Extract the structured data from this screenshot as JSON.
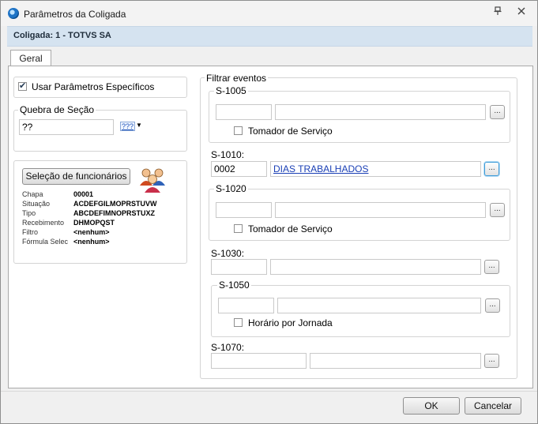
{
  "window": {
    "title": "Parâmetros da Coligada",
    "pin_icon": "pin-icon",
    "close_icon": "close-icon"
  },
  "header": {
    "text": "Coligada: 1 - TOTVS SA"
  },
  "tabs": [
    {
      "label": "Geral"
    }
  ],
  "left": {
    "usar_parametros": {
      "label": "Usar Parâmetros Específicos",
      "checked": true
    },
    "quebra": {
      "legend": "Quebra de Seção",
      "value": "??",
      "picker_label": "???"
    },
    "selecao": {
      "button_label": "Seleção de funcionários",
      "rows": [
        {
          "key": "Chapa",
          "value": "00001"
        },
        {
          "key": "Situação",
          "value": "ACDEFGILMOPRSTUVW"
        },
        {
          "key": "Tipo",
          "value": "ABCDEFIMNOPRSTUXZ"
        },
        {
          "key": "Recebimento",
          "value": "DHMOPQST"
        },
        {
          "key": "Filtro",
          "value": "<nenhum>"
        },
        {
          "key": "Fórmula Selec",
          "value": "<nenhum>"
        }
      ]
    }
  },
  "right": {
    "legend": "Filtrar eventos",
    "s1005": {
      "label": "S-1005",
      "code": "",
      "desc": "",
      "checkbox_label": "Tomador de Serviço",
      "button": "..."
    },
    "s1010": {
      "label": "S-1010:",
      "code": "0002",
      "desc": "DIAS TRABALHADOS",
      "button": "..."
    },
    "s1020": {
      "label": "S-1020",
      "code": "",
      "desc": "",
      "checkbox_label": "Tomador de Serviço",
      "button": "..."
    },
    "s1030": {
      "label": "S-1030:",
      "code": "",
      "desc": "",
      "button": "..."
    },
    "s1050": {
      "label": "S-1050",
      "code": "",
      "desc": "",
      "checkbox_label": "Horário por Jornada",
      "button": "..."
    },
    "s1070": {
      "label": "S-1070:",
      "code": "",
      "desc": "",
      "button": "..."
    }
  },
  "footer": {
    "ok_label": "OK",
    "cancel_label": "Cancelar"
  }
}
